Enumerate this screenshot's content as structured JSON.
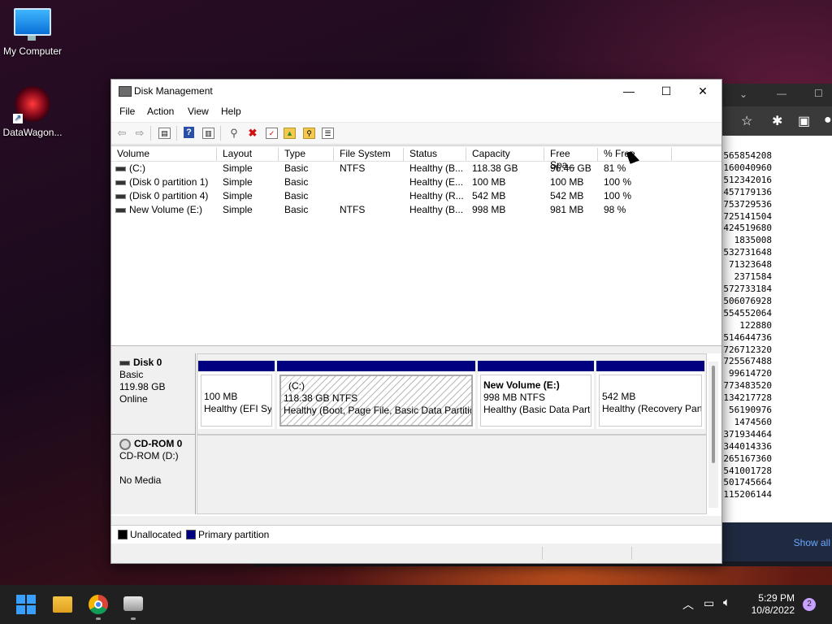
{
  "desktop": {
    "icons": [
      {
        "label": "My Computer",
        "icon": "monitor-icon"
      },
      {
        "label": "DataWagon...",
        "icon": "datawagon-logo-icon"
      }
    ]
  },
  "background_window": {
    "numbers": [
      "565854208",
      "160040960",
      "512342016",
      "457179136",
      "753729536",
      "725141504",
      "424519680",
      "1835008",
      "532731648",
      "71323648",
      "2371584",
      "572733184",
      "506076928",
      "554552064",
      "122880",
      "514644736",
      "726712320",
      "725567488",
      "99614720",
      "773483520",
      "134217728",
      "56190976",
      "1474560",
      "371934464",
      "344014336",
      "265167360",
      "541001728",
      "501745664",
      "115206144"
    ],
    "show_all": "Show all"
  },
  "window": {
    "title": "Disk Management",
    "controls": {
      "minimize": "—",
      "maximize": "☐",
      "close": "✕"
    },
    "menu": [
      "File",
      "Action",
      "View",
      "Help"
    ],
    "toolbar_icons": [
      "back-arrow-icon",
      "forward-arrow-icon",
      "properties-icon",
      "help-icon",
      "view-icon",
      "connect-icon",
      "delete-icon",
      "check-icon",
      "folder-up-icon",
      "search-folder-icon",
      "list-icon"
    ]
  },
  "volumes": {
    "columns": [
      "Volume",
      "Layout",
      "Type",
      "File System",
      "Status",
      "Capacity",
      "Free Spa...",
      "% Free"
    ],
    "rows": [
      [
        "(C:)",
        "Simple",
        "Basic",
        "NTFS",
        "Healthy (B...",
        "118.38 GB",
        "96.46 GB",
        "81 %"
      ],
      [
        "(Disk 0 partition 1)",
        "Simple",
        "Basic",
        "",
        "Healthy (E...",
        "100 MB",
        "100 MB",
        "100 %"
      ],
      [
        "(Disk 0 partition 4)",
        "Simple",
        "Basic",
        "",
        "Healthy (R...",
        "542 MB",
        "542 MB",
        "100 %"
      ],
      [
        "New Volume (E:)",
        "Simple",
        "Basic",
        "NTFS",
        "Healthy (B...",
        "998 MB",
        "981 MB",
        "98 %"
      ]
    ]
  },
  "disks": {
    "disk0": {
      "name": "Disk 0",
      "type": "Basic",
      "size": "119.98 GB",
      "state": "Online",
      "partitions": [
        {
          "title": "",
          "size": "100 MB",
          "status": "Healthy (EFI Sys"
        },
        {
          "title": "(C:)",
          "size": "118.38 GB NTFS",
          "status": "Healthy (Boot, Page File, Basic Data Partition"
        },
        {
          "title": "New Volume  (E:)",
          "size": "998 MB NTFS",
          "status": "Healthy (Basic Data Parti"
        },
        {
          "title": "",
          "size": "542 MB",
          "status": "Healthy (Recovery Part"
        }
      ]
    },
    "cdrom0": {
      "name": "CD-ROM 0",
      "drive": "CD-ROM (D:)",
      "media": "No Media"
    }
  },
  "legend": {
    "unallocated": "Unallocated",
    "primary": "Primary partition",
    "unallocated_color": "#000000",
    "primary_color": "#000080"
  },
  "taskbar": {
    "time": "5:29 PM",
    "date": "10/8/2022",
    "notifications": "2",
    "apps": [
      "windows-start-icon",
      "file-explorer-icon",
      "chrome-icon",
      "disk-management-icon"
    ]
  }
}
